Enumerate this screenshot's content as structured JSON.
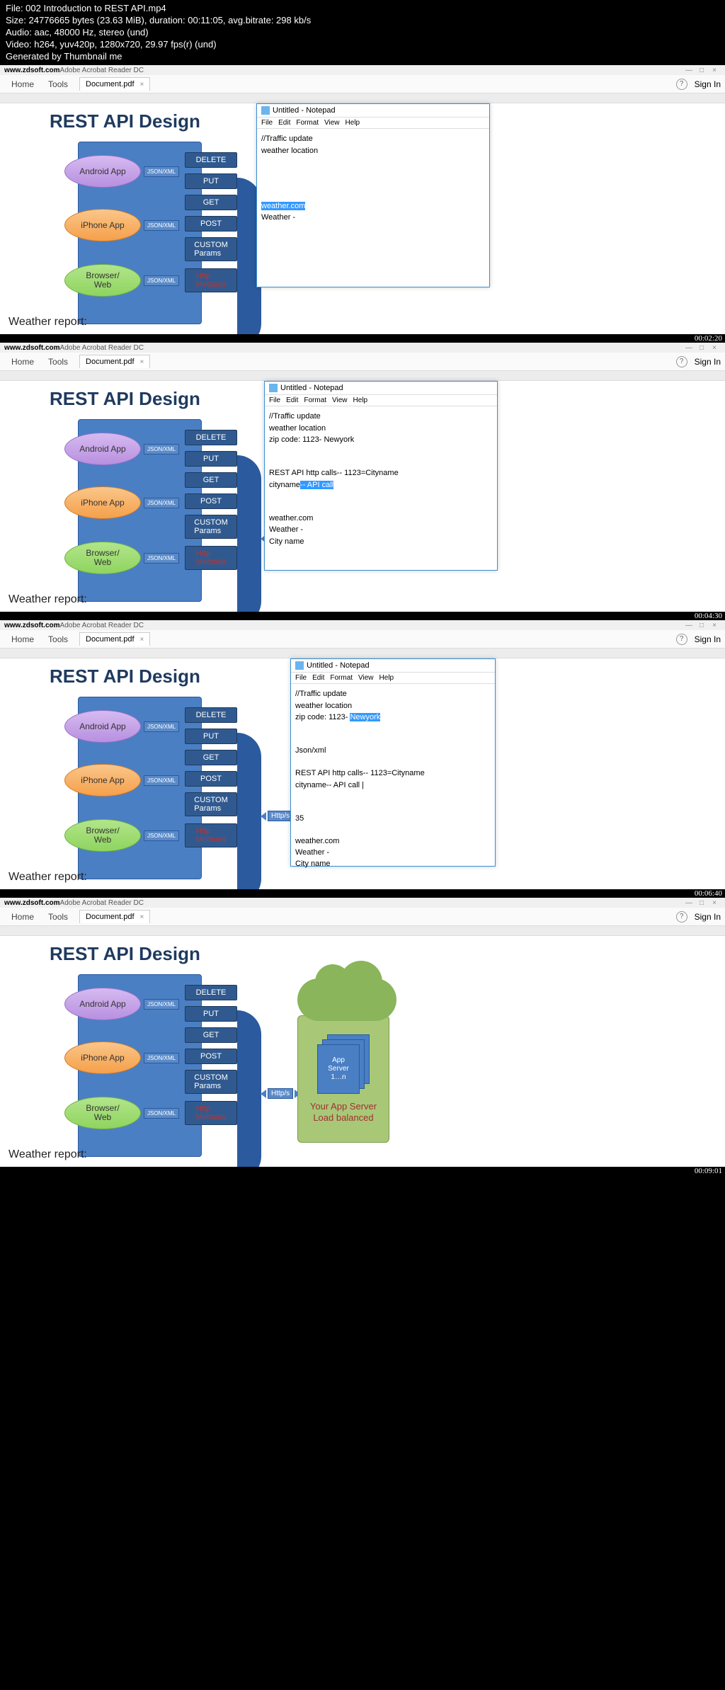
{
  "header": {
    "file": "File: 002 Introduction to REST API.mp4",
    "size": "Size: 24776665 bytes (23.63 MiB), duration: 00:11:05, avg.bitrate: 298 kb/s",
    "audio": "Audio: aac, 48000 Hz, stereo (und)",
    "video": "Video: h264, yuv420p, 1280x720, 29.97 fps(r) (und)",
    "gen": "Generated by Thumbnail me"
  },
  "acrobat": {
    "url": "www.zdsoft.com",
    "app": " Adobe Acrobat Reader DC",
    "home": "Home",
    "tools": "Tools",
    "doc": "Document.pdf",
    "signin": "Sign In"
  },
  "diagram": {
    "title": "REST API Design",
    "android": "Android App",
    "iphone": "iPhone App",
    "browser": "Browser/\nWeb",
    "json": "JSON/XML",
    "delete": "DELETE",
    "put": "PUT",
    "get": "GET",
    "post": "POST",
    "custom": "CUSTOM\nParams",
    "httpm": "Http\nMethods",
    "https": "Http/s",
    "appserver": "App\nServer\n1…n",
    "serverlabel": "Your App Server\nLoad balanced",
    "serverlabel_cut": "Your App\nLoad ba",
    "weather": "Weather report:"
  },
  "notepad": {
    "title": "Untitled - Notepad",
    "file": "File",
    "edit": "Edit",
    "format": "Format",
    "view": "View",
    "help": "Help"
  },
  "frame1": {
    "ts": "00:02:20",
    "line1": "//Traffic update",
    "line2": "weather location",
    "hl": "weather.com",
    "line3": "Weather -"
  },
  "frame2": {
    "ts": "00:04:30",
    "line1": "//Traffic update",
    "line2": "weather location",
    "line3": "zip code: 1123- Newyork",
    "line4": "REST API http calls-- 1123=Cityname",
    "line5a": "cityname",
    "hl": "-- API call",
    "line6": "weather.com",
    "line7": "Weather -",
    "line8": "City name"
  },
  "frame3": {
    "ts": "00:06:40",
    "line1": "//Traffic update",
    "line2": "weather location",
    "line3a": "zip code: 1123- ",
    "hl": "Newyork",
    "line4": "Json/xml",
    "line5": "REST API http calls-- 1123=Cityname",
    "line6": "cityname-- API call |",
    "line7": "35",
    "line8": "weather.com",
    "line9": "Weather -",
    "line10": "City name"
  },
  "frame4": {
    "ts": "00:09:01"
  }
}
